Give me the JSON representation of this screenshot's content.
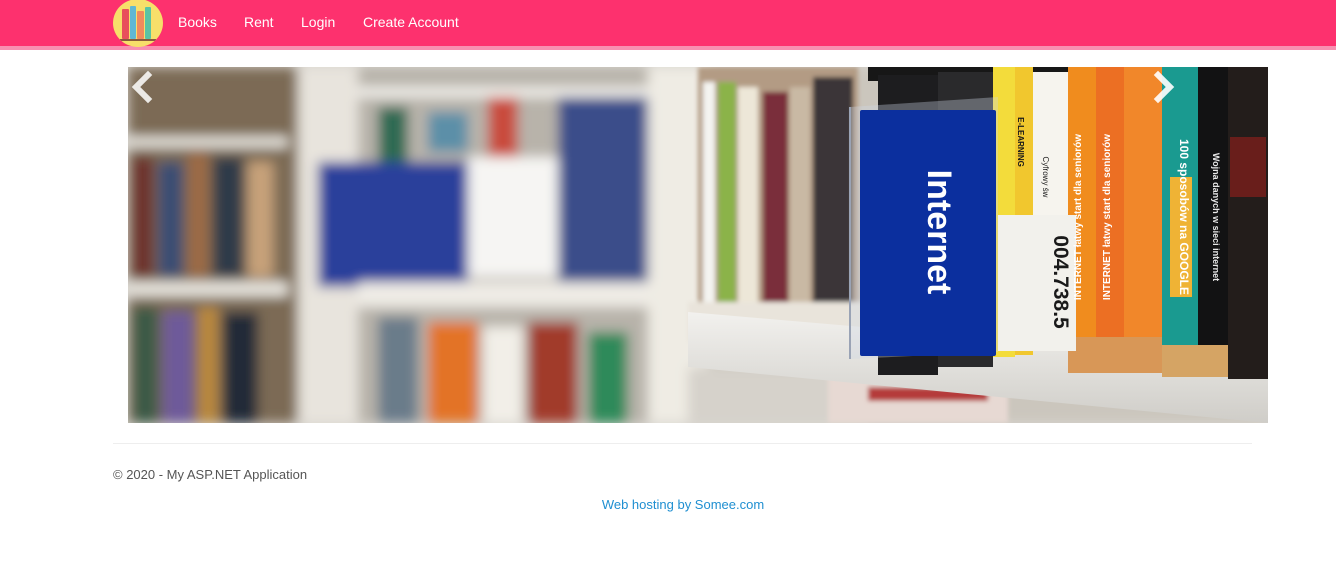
{
  "navbar": {
    "brand_logo": "books-logo-icon",
    "links": [
      "Books",
      "Rent",
      "Login",
      "Create Account"
    ],
    "background_color": "#fd316e"
  },
  "carousel": {
    "slide_sign_text": "Internet",
    "slide_call_number": "004.738.5",
    "slide_spines": [
      "INTERNET łatwy start dla seniorów",
      "INTERNET łatwy start dla seniorów",
      "100 sposobów na GOOGLE",
      "Wojna danych w sieci internet",
      "E-LEARNING",
      "Cyfrowy św"
    ],
    "prev_icon": "chevron-left-icon",
    "next_icon": "chevron-right-icon"
  },
  "footer": {
    "copyright": "© 2020 - My ASP.NET Application",
    "hosting_link": "Web hosting by Somee.com"
  }
}
